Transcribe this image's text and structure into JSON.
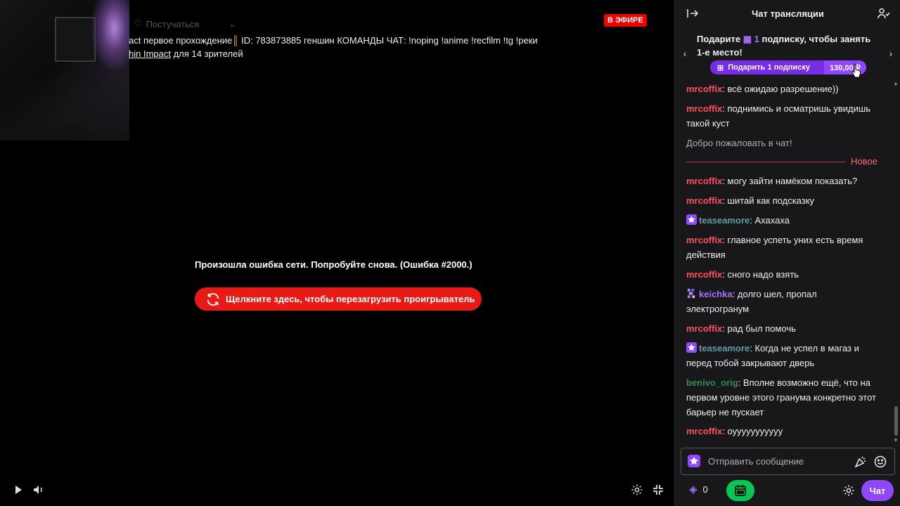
{
  "player": {
    "follow_label": "Постучаться",
    "live_badge": "В ЭФИРЕ",
    "title_prefix": "act первое прохождение",
    "title_rest": " ID: 783873885 геншин КОМАНДЫ ЧАТ: !noping !anime !recfilm !tg !реки",
    "game_name": "hin Impact",
    "viewers_text": " для 14 зрителей",
    "error_message": "Произошла ошибка сети. Попробуйте снова. (Ошибка #2000.)",
    "reload_label": "Щелкните здесь, чтобы перезагрузить проигрыватель",
    "icons": {
      "play": "play-icon",
      "volume": "volume-icon",
      "settings": "gear-icon",
      "fullscreen": "exit-fullscreen-icon"
    }
  },
  "chat": {
    "header_title": "Чат трансляции",
    "promo": {
      "text_before": "Подарите ",
      "num": "1",
      "text_after": " подписку, чтобы занять 1-е место!",
      "gift_label": "Подарить 1 подписку",
      "price": "130,00 ₽"
    },
    "messages": [
      {
        "user": "mrcoffix",
        "text": ": всё ожидаю разрешение))",
        "color": "#ff4f5e",
        "badge": ""
      },
      {
        "user": "mrcoffix",
        "text": ": поднимись и осматришь увидишь такой куст",
        "color": "#ff4f5e",
        "badge": ""
      },
      {
        "user": "mrcoffix",
        "text": ": могу зайти намёком показать?",
        "color": "#ff4f5e",
        "badge": ""
      },
      {
        "user": "mrcoffix",
        "text": ": шитай как подсказку",
        "color": "#ff4f5e",
        "badge": ""
      },
      {
        "user": "teaseamore",
        "text": ": Ахахаха",
        "color": "#5f9ea0",
        "badge": "star-badge"
      },
      {
        "user": "mrcoffix",
        "text": ": главное успеть уних есть время действия",
        "color": "#ff4f5e",
        "badge": ""
      },
      {
        "user": "mrcoffix",
        "text": ": сного надо взять",
        "color": "#ff4f5e",
        "badge": ""
      },
      {
        "user": "keichka",
        "text": ": долго шел, пропал электрогранум",
        "color": "#a970ff",
        "badge": "pixel-badge"
      },
      {
        "user": "mrcoffix",
        "text": ": рад был помочь",
        "color": "#ff4f5e",
        "badge": ""
      },
      {
        "user": "teaseamore",
        "text": ": Когда не успел в магаз и перед тобой закрывают дверь",
        "color": "#5f9ea0",
        "badge": "star-badge"
      },
      {
        "user": "benivo_orig",
        "text": ": Вполне возможно ещё, что на первом уровне этого гранума конкретно этот барьер не пускает",
        "color": "#2e8b57",
        "badge": ""
      },
      {
        "user": "mrcoffix",
        "text": ": оууууууууууу",
        "color": "#ff4f5e",
        "badge": ""
      }
    ],
    "welcome": "Добро пожаловать в чат!",
    "new_label": "Новое",
    "input_placeholder": "Отправить сообщение",
    "points": "0",
    "send_label": "Чат"
  }
}
